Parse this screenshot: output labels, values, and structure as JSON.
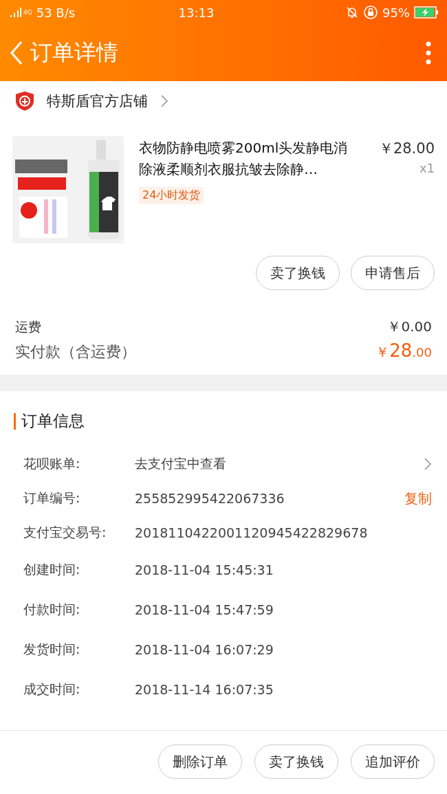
{
  "status_bar": {
    "network": "4G",
    "speed": "53 B/s",
    "time": "13:13",
    "battery": "95%",
    "charging": true
  },
  "header": {
    "title": "订单详情"
  },
  "shop": {
    "name": "特斯盾官方店铺"
  },
  "product": {
    "title": "衣物防静电喷雾200ml头发静电消除液柔顺剂衣服抗皱去除静…",
    "tag": "24小时发货",
    "price": "￥28.00",
    "quantity": "x1"
  },
  "product_actions": [
    "卖了换钱",
    "申请售后"
  ],
  "fees": {
    "shipping_label": "运费",
    "shipping_value": "￥0.00",
    "total_label": "实付款（含运费）",
    "total_currency": "￥",
    "total_integer": "28",
    "total_decimal": ".00"
  },
  "order_info": {
    "title": "订单信息",
    "rows": [
      {
        "label": "花呗账单:",
        "value": "去支付宝中查看",
        "kind": "chevron"
      },
      {
        "label": "订单编号:",
        "value": "255852995422067336",
        "kind": "copy",
        "action_text": "复制"
      },
      {
        "label": "支付宝交易号:",
        "value": "2018110422001120945422829678"
      },
      {
        "label": "创建时间:",
        "value": "2018-11-04 15:45:31"
      },
      {
        "label": "付款时间:",
        "value": "2018-11-04 15:47:59"
      },
      {
        "label": "发货时间:",
        "value": "2018-11-04 16:07:29"
      },
      {
        "label": "成交时间:",
        "value": "2018-11-14 16:07:35"
      }
    ]
  },
  "bottom_actions": [
    "删除订单",
    "卖了换钱",
    "追加评价"
  ]
}
